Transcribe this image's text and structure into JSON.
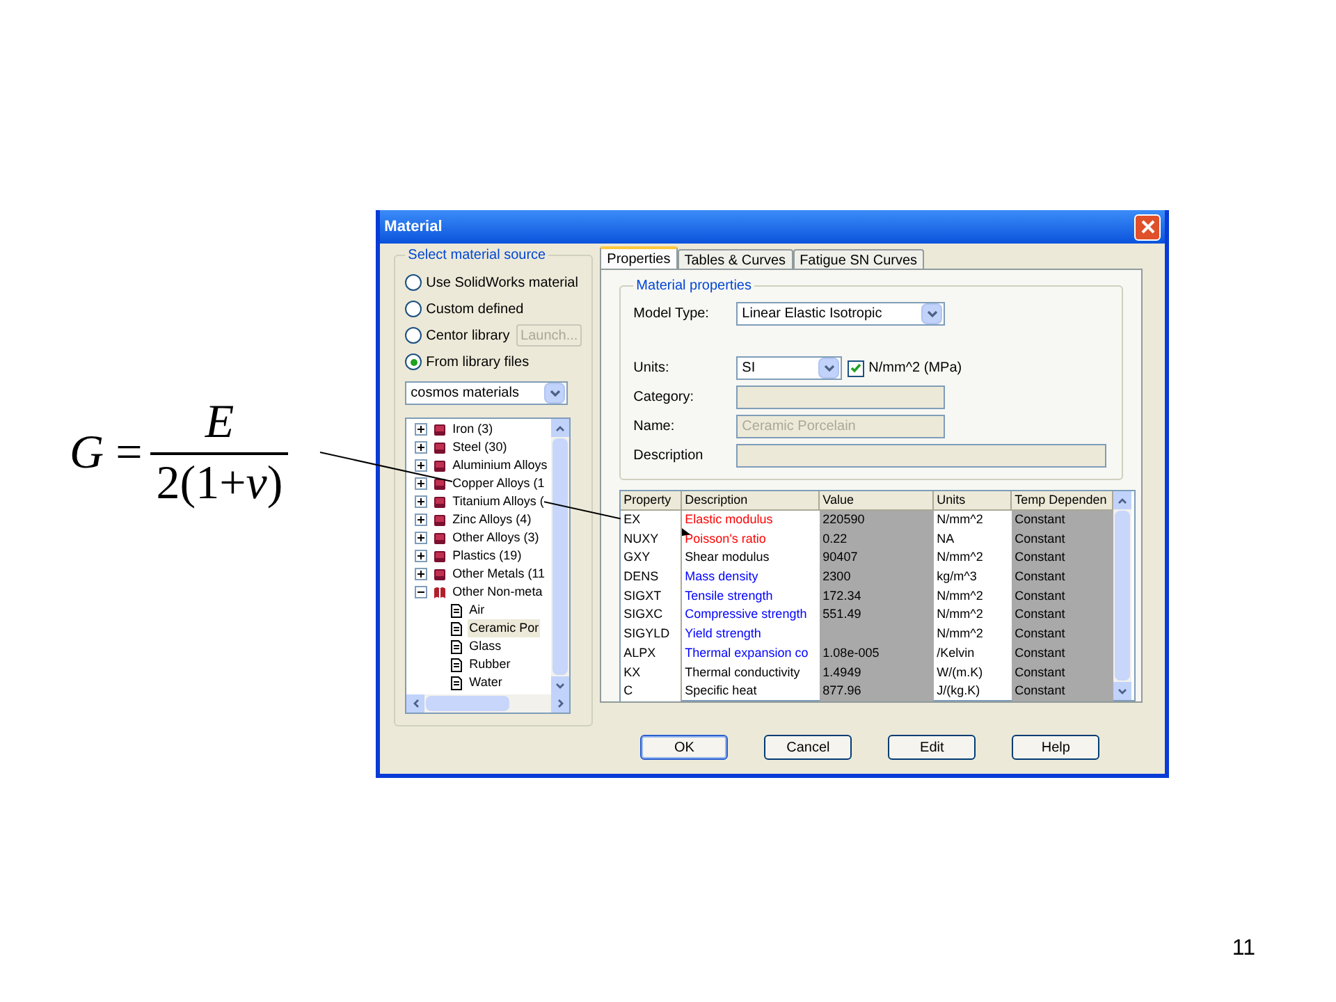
{
  "formula": {
    "lhs": "*G* =",
    "numerator": "*E*",
    "denominator": "2(1+*ν*)"
  },
  "window": {
    "title": "Material"
  },
  "source_panel": {
    "legend": "Select material source",
    "options": [
      {
        "label": "Use SolidWorks material",
        "selected": false
      },
      {
        "label": "Custom defined",
        "selected": false
      },
      {
        "label": "Centor library",
        "selected": false
      },
      {
        "label": "From library files",
        "selected": true
      }
    ],
    "launch_button": {
      "label": "Launch...",
      "disabled": true
    },
    "library_select": {
      "value": "cosmos materials"
    },
    "tree": [
      {
        "label": "Iron (3)",
        "expanded": false
      },
      {
        "label": "Steel (30)",
        "expanded": false
      },
      {
        "label": "Aluminium Alloys",
        "expanded": false
      },
      {
        "label": "Copper Alloys (1",
        "expanded": false
      },
      {
        "label": "Titanium Alloys (",
        "expanded": false
      },
      {
        "label": "Zinc Alloys (4)",
        "expanded": false
      },
      {
        "label": "Other Alloys (3)",
        "expanded": false
      },
      {
        "label": "Plastics (19)",
        "expanded": false
      },
      {
        "label": "Other Metals (11",
        "expanded": false
      },
      {
        "label": "Other Non-meta",
        "expanded": true,
        "children": [
          {
            "label": "Air",
            "selected": false
          },
          {
            "label": "Ceramic Por",
            "selected": true
          },
          {
            "label": "Glass",
            "selected": false
          },
          {
            "label": "Rubber",
            "selected": false
          },
          {
            "label": "Water",
            "selected": false
          }
        ]
      }
    ]
  },
  "tabs": [
    {
      "label": "Properties",
      "selected": true
    },
    {
      "label": "Tables & Curves",
      "selected": false
    },
    {
      "label": "Fatigue SN Curves",
      "selected": false
    }
  ],
  "material_properties": {
    "legend": "Material properties",
    "model_type": {
      "label": "Model Type:",
      "value": "Linear Elastic Isotropic"
    },
    "units": {
      "label": "Units:",
      "value": "SI",
      "checkbox": {
        "label": "N/mm^2 (MPa)",
        "checked": true
      }
    },
    "category": {
      "label": "Category:"
    },
    "name": {
      "label": "Name:",
      "value": "Ceramic Porcelain",
      "disabled": true
    },
    "description": {
      "label": "Description"
    }
  },
  "table": {
    "columns": [
      "Property",
      "Description",
      "Value",
      "Units",
      "Temp Dependen"
    ],
    "rows": [
      {
        "property": "EX",
        "description": "Elastic modulus",
        "color": "#ff0000",
        "value": "220590",
        "units": "N/mm^2",
        "temp": "Constant"
      },
      {
        "property": "NUXY",
        "description": "Poisson's ratio",
        "color": "#ff0000",
        "value": "0.22",
        "units": "NA",
        "temp": "Constant"
      },
      {
        "property": "GXY",
        "description": "Shear modulus",
        "color": "#000000",
        "value": "90407",
        "units": "N/mm^2",
        "temp": "Constant"
      },
      {
        "property": "DENS",
        "description": "Mass density",
        "color": "#0000ff",
        "value": "2300",
        "units": "kg/m^3",
        "temp": "Constant"
      },
      {
        "property": "SIGXT",
        "description": "Tensile strength",
        "color": "#0000ff",
        "value": "172.34",
        "units": "N/mm^2",
        "temp": "Constant"
      },
      {
        "property": "SIGXC",
        "description": "Compressive strength",
        "color": "#0000ff",
        "value": "551.49",
        "units": "N/mm^2",
        "temp": "Constant"
      },
      {
        "property": "SIGYLD",
        "description": "Yield strength",
        "color": "#0000ff",
        "units": "N/mm^2",
        "temp": "Constant"
      },
      {
        "property": "ALPX",
        "description": "Thermal expansion co",
        "color": "#0000ff",
        "value": "1.08e-005",
        "units": "/Kelvin",
        "temp": "Constant"
      },
      {
        "property": "KX",
        "description": "Thermal conductivity",
        "color": "#000000",
        "value": "1.4949",
        "units": "W/(m.K)",
        "temp": "Constant"
      },
      {
        "property": "C",
        "description": "Specific heat",
        "color": "#000000",
        "value": "877.96",
        "units": "J/(kg.K)",
        "temp": "Constant"
      }
    ]
  },
  "buttons": [
    "OK",
    "Cancel",
    "Edit",
    "Help"
  ],
  "page_number": "11"
}
